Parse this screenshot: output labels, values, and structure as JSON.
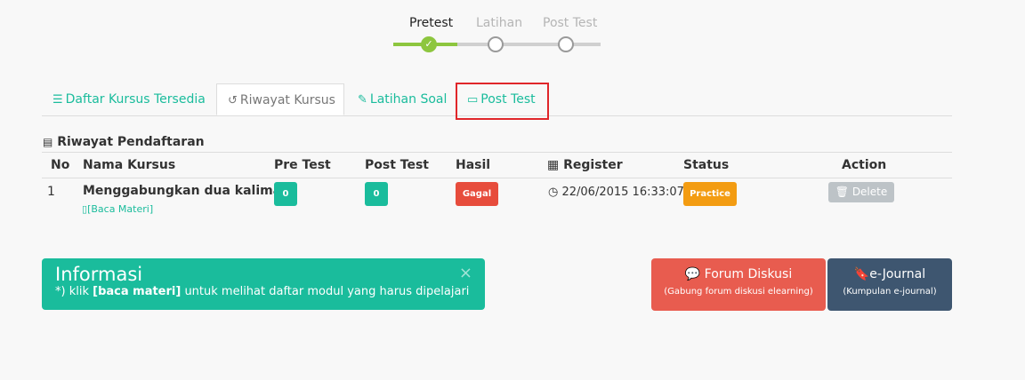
{
  "stepper": {
    "steps": [
      {
        "label": "Pretest",
        "state": "done"
      },
      {
        "label": "Latihan",
        "state": "pending"
      },
      {
        "label": "Post Test",
        "state": "pending"
      }
    ],
    "check_glyph": "✓"
  },
  "tabs": [
    {
      "label": "Daftar Kursus Tersedia",
      "icon": "list-icon"
    },
    {
      "label": "Riwayat Kursus",
      "icon": "history-icon",
      "active": true
    },
    {
      "label": "Latihan Soal",
      "icon": "pencil-icon"
    },
    {
      "label": "Post Test",
      "icon": "monitor-icon",
      "highlighted": true
    }
  ],
  "section": {
    "title": "Riwayat Pendaftaran",
    "icon": "list-alt-icon"
  },
  "table": {
    "headers": [
      "No",
      "Nama Kursus",
      "Pre Test",
      "Post Test",
      "Hasil",
      "Register",
      "Status",
      "Action"
    ],
    "rows": [
      {
        "no": "1",
        "course": "Menggabungkan dua kalimat",
        "link": "[Baca Materi]",
        "pre_test": "0",
        "post_test": "0",
        "hasil": "Gagal",
        "register": "22/06/2015 16:33:07",
        "status": "Practice",
        "action": "Delete"
      }
    ]
  },
  "info": {
    "title": "Informasi",
    "body_prefix": "*) klik ",
    "body_bold": "[baca materi]",
    "body_suffix": " untuk melihat daftar modul yang harus dipelajari",
    "close": "×"
  },
  "buttons": {
    "forum": {
      "label": "Forum Diskusi",
      "sub": "(Gabung forum diskusi elearning)"
    },
    "journal": {
      "label": "e-Journal",
      "sub": "(Kumpulan e-journal)"
    }
  },
  "colors": {
    "accent": "#1abc9c",
    "stepper_done": "#8dc63f",
    "danger": "#e74c3c",
    "warning": "#f39c12",
    "disabled": "#bdc3c7",
    "forum": "#e85c4f",
    "journal": "#3e5670",
    "highlight": "#e0262a"
  }
}
